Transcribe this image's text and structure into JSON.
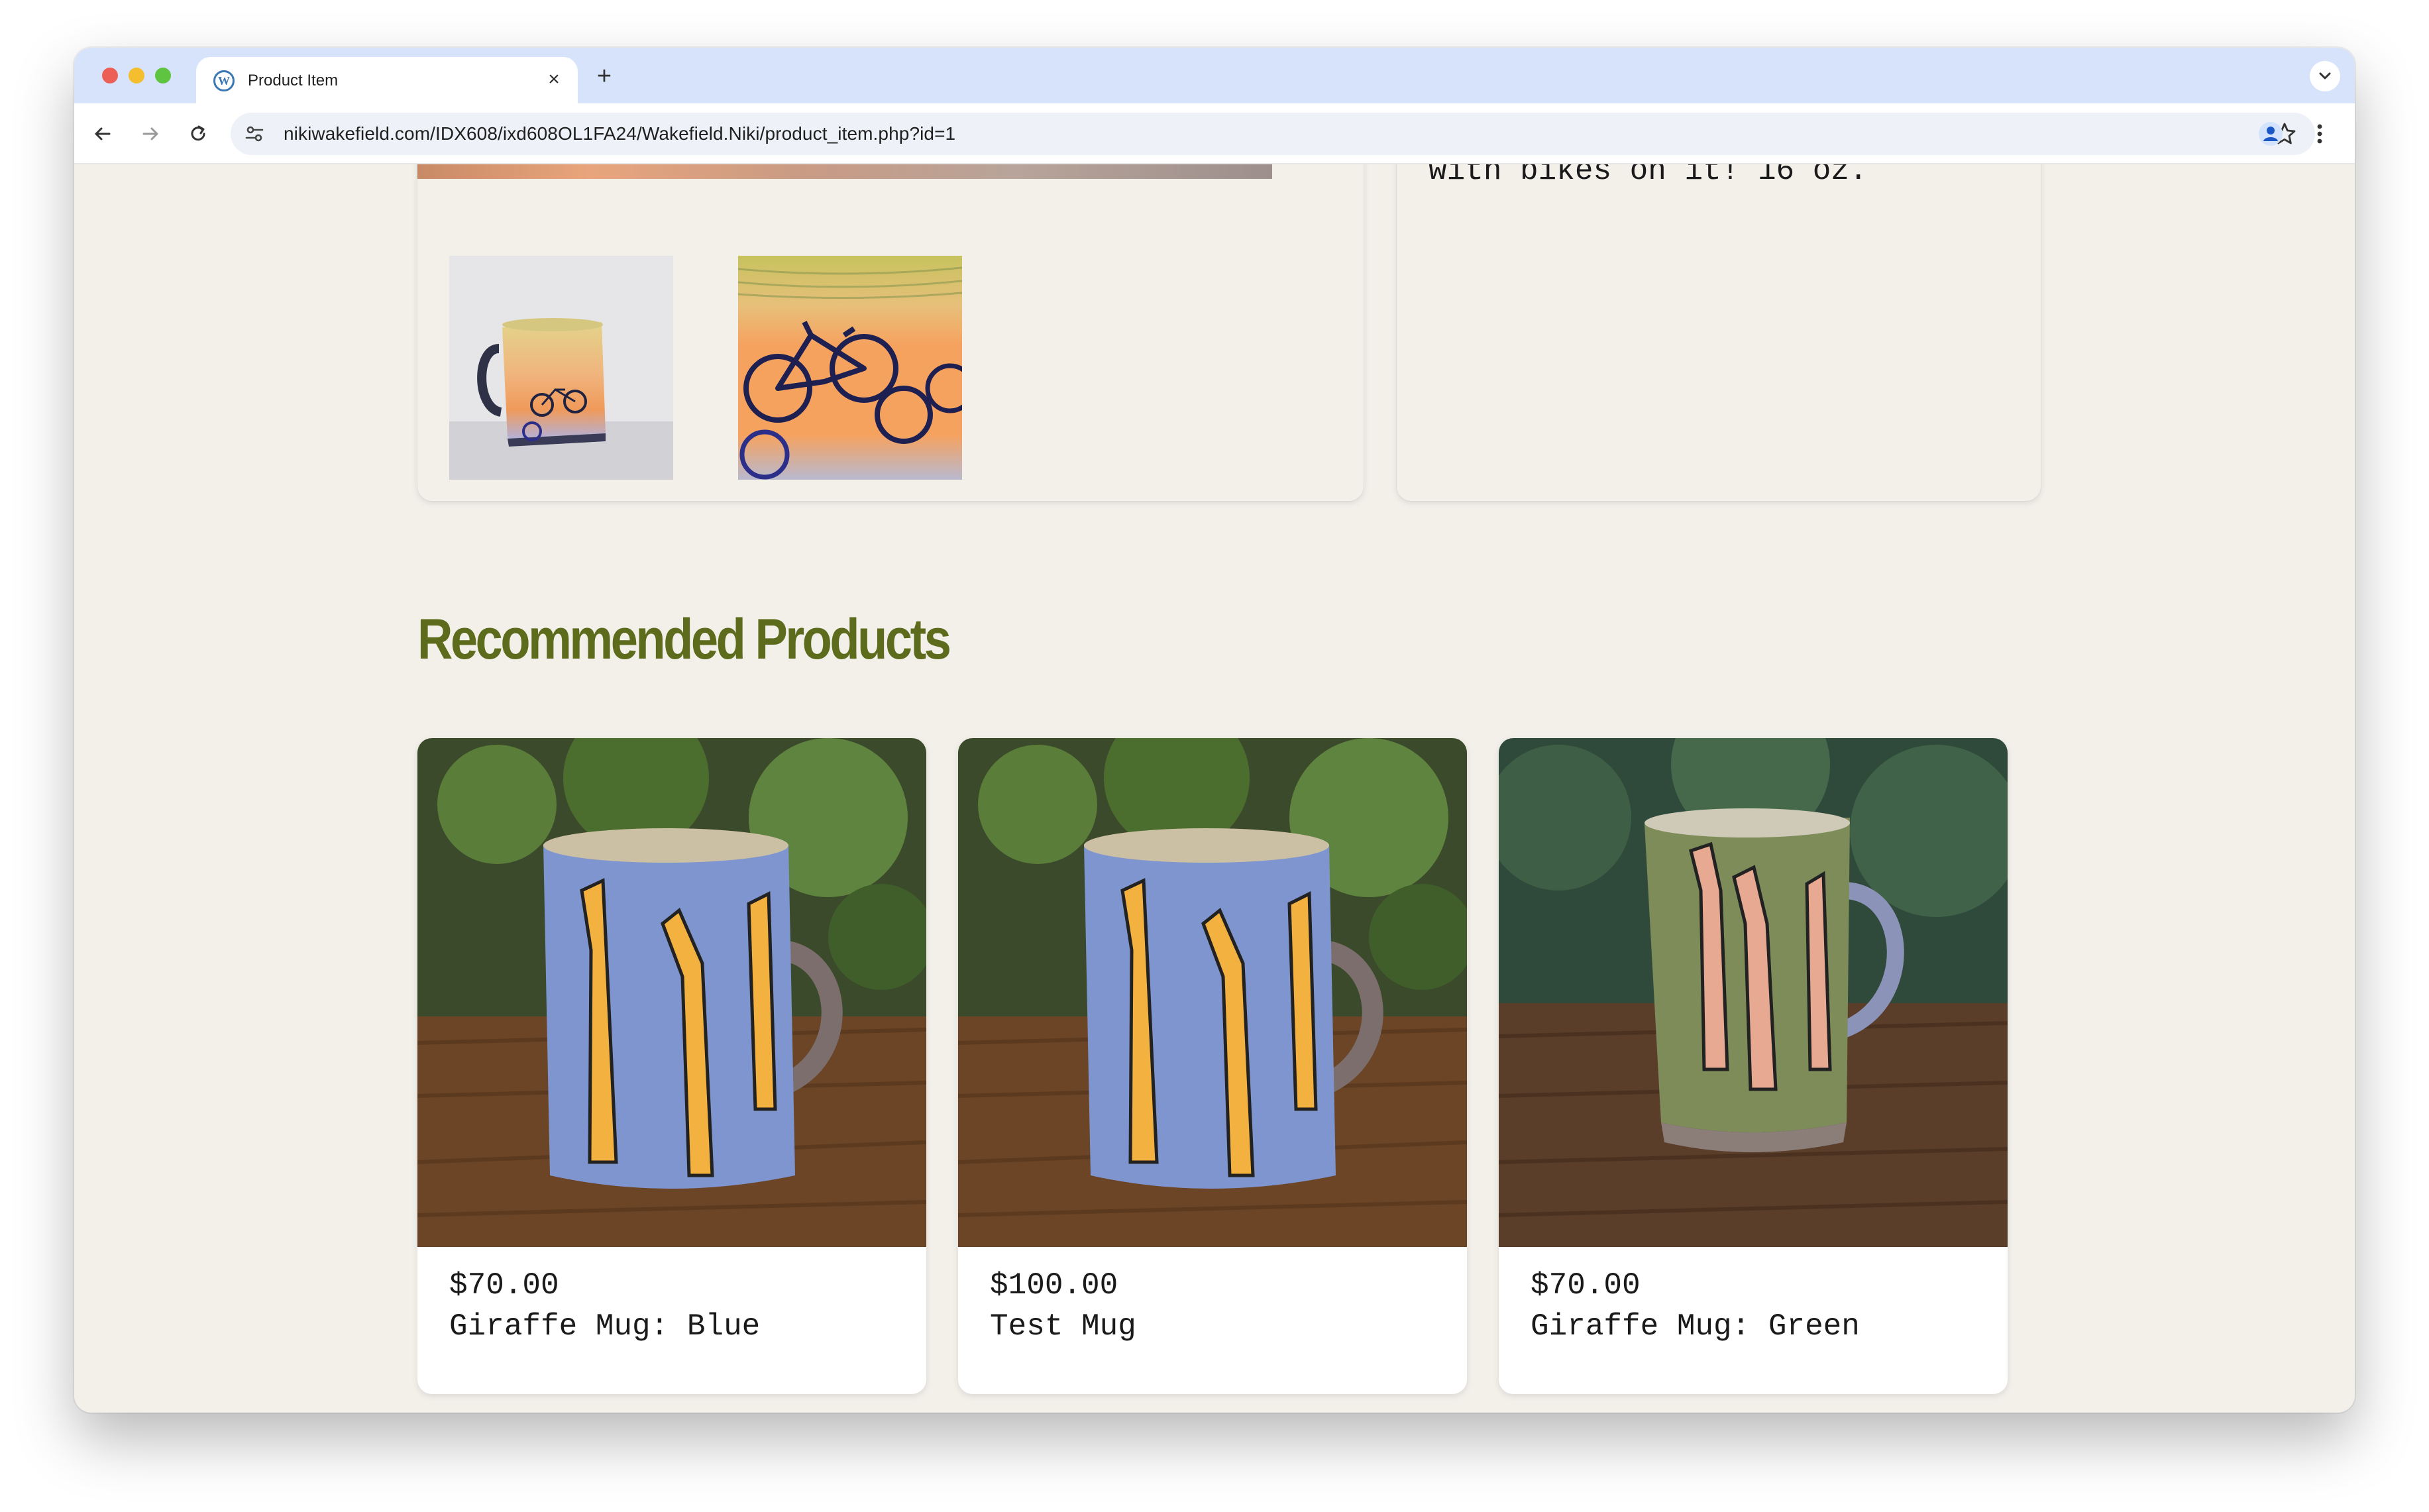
{
  "browser": {
    "tab_title": "Product Item",
    "url": "nikiwakefield.com/IDX608/ixd608OL1FA24/Wakefield.Niki/product_item.php?id=1",
    "traffic_lights": [
      "#ec5f57",
      "#f4be2f",
      "#5fc43f"
    ],
    "favicon": "wordpress-icon"
  },
  "product": {
    "description_tail": "with bikes on it! 16 oz.",
    "thumbnails": [
      {
        "name": "bike-mug-full-thumbnail"
      },
      {
        "name": "bike-mug-detail-thumbnail"
      }
    ]
  },
  "recommended": {
    "title": "Recommended Products",
    "items": [
      {
        "price": "$70.00",
        "name": "Giraffe Mug: Blue",
        "glaze": "#7f95cf"
      },
      {
        "price": "$100.00",
        "name": "Test Mug",
        "glaze": "#7f95cf"
      },
      {
        "price": "$70.00",
        "name": "Giraffe Mug: Green",
        "glaze": "#7e8c5a"
      }
    ]
  },
  "colors": {
    "page_background": "#f3f0ea",
    "heading_olive": "#5c6b1c",
    "tab_strip": "#d7e3fb"
  }
}
